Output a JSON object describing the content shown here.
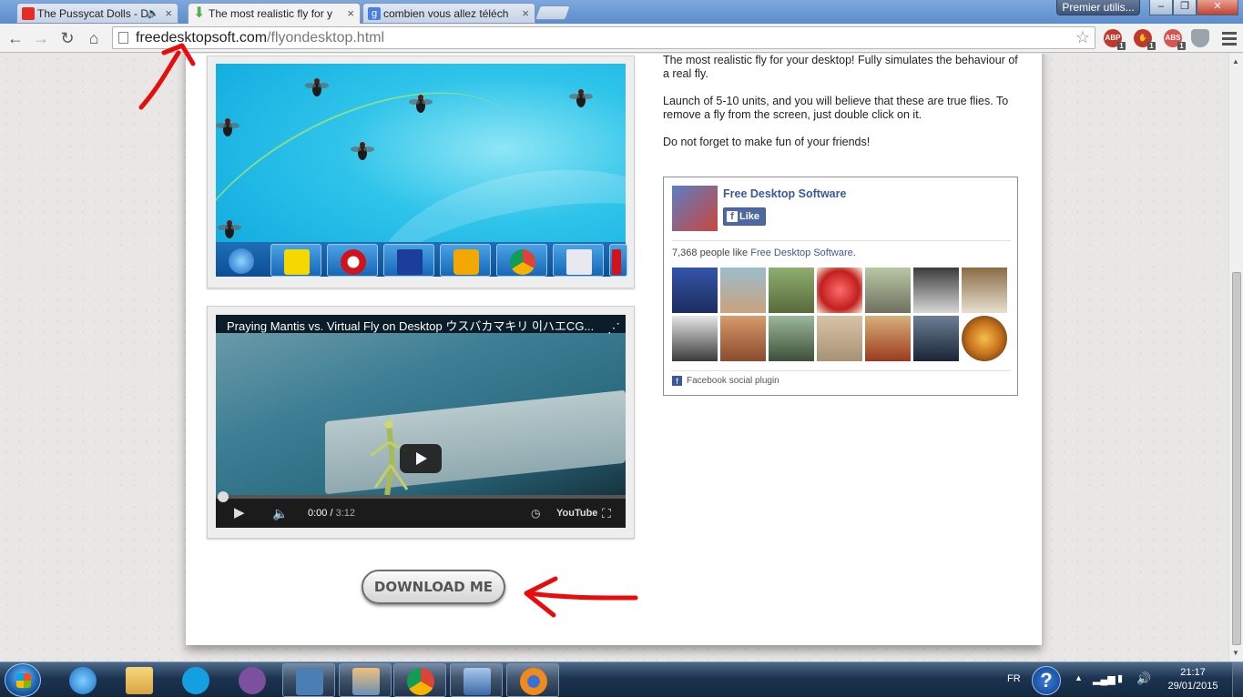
{
  "browser": {
    "tabs": [
      {
        "title": "The Pussycat Dolls - Do",
        "active": false,
        "audio": true
      },
      {
        "title": "The most realistic fly for y",
        "active": true
      },
      {
        "title": "combien vous allez téléch",
        "active": false
      }
    ],
    "profile_label": "Premier utilis...",
    "url_host": "freedesktopsoft.com",
    "url_path": "/flyondesktop.html",
    "extensions": [
      {
        "label": "ABP",
        "count": "1",
        "color": "#c0392b"
      },
      {
        "label": "",
        "count": "1",
        "color": "#c0392b"
      },
      {
        "label": "ABS",
        "count": "1",
        "color": "#d9534f"
      }
    ]
  },
  "page": {
    "description": [
      "The most realistic fly for your desktop! Fully simulates the behaviour of a real fly.",
      "Launch of 5-10 units, and you will believe that these are true flies. To remove a fly from the screen, just double click on it.",
      "Do not forget to make fun of your friends!"
    ],
    "video": {
      "title": "Praying Mantis vs. Virtual Fly on Desktop ウスバカマキリ 이ハエCG...",
      "current_time": "0:00",
      "duration": "3:12",
      "progress_fraction": 0.0,
      "brand": "YouTube"
    },
    "download_button": "DOWNLOAD ME"
  },
  "facebook": {
    "page_name": "Free Desktop Software",
    "like_label": "Like",
    "count_text": "7,368 people like ",
    "count_link": "Free Desktop Software",
    "count_suffix": ".",
    "plugin_label": "Facebook social plugin"
  },
  "taskbar": {
    "language": "FR",
    "time": "21:17",
    "date": "29/01/2015"
  }
}
